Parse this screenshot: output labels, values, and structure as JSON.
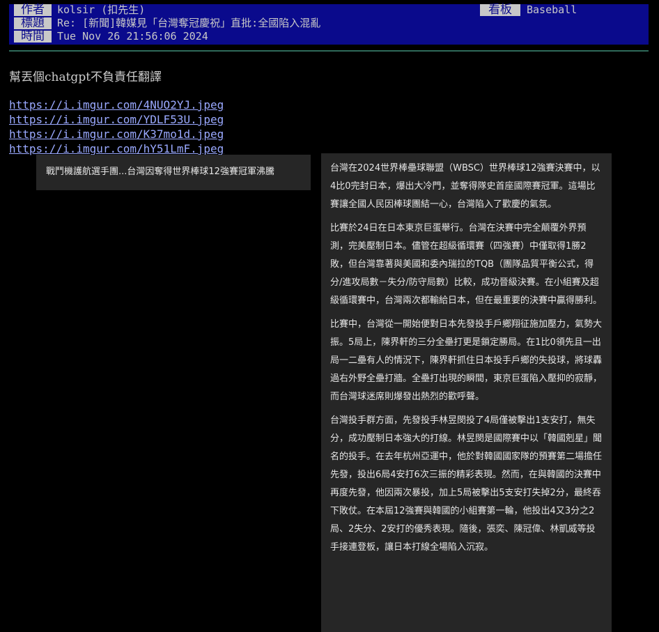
{
  "header": {
    "author_label": "作者",
    "author_value": "kolsir (扣先生)",
    "title_label": "標題",
    "title_value": "Re: [新聞]韓媒見「台灣奪冠慶祝」直批:全國陷入混亂",
    "time_label": "時間",
    "time_value": "Tue Nov 26 21:56:06 2024",
    "board_label": "看板",
    "board_value": "Baseball"
  },
  "body": {
    "intro": "幫丟個chatgpt不負責任翻譯",
    "links": [
      "https://i.imgur.com/4NUO2YJ.jpeg",
      "https://i.imgur.com/YDLF53U.jpeg",
      "https://i.imgur.com/K37mo1d.jpeg",
      "https://i.imgur.com/hY51LmF.jpeg"
    ]
  },
  "preview_left": {
    "text": "戰鬥機護航選手團...台灣因奪得世界棒球12強賽冠軍沸騰"
  },
  "preview_right": {
    "paragraphs": [
      "台灣在2024世界棒壘球聯盟（WBSC）世界棒球12強賽決賽中，以4比0完封日本，爆出大冷門，並奪得隊史首座國際賽冠軍。這場比賽讓全國人民因棒球團結一心，台灣陷入了歡慶的氣氛。",
      "比賽於24日在日本東京巨蛋舉行。台灣在決賽中完全顛覆外界預測，完美壓制日本。儘管在超級循環賽（四強賽）中僅取得1勝2敗，但台灣靠著與美國和委內瑞拉的TQB（團隊品質平衡公式，得分/進攻局數－失分/防守局數）比較，成功晉級決賽。在小組賽及超級循環賽中，台灣兩次都輸給日本，但在最重要的決賽中贏得勝利。",
      "比賽中，台灣從一開始便對日本先發投手戶鄉翔征施加壓力，氣勢大振。5局上，陳界軒的三分全壘打更是鎖定勝局。在1比0領先且一出局一二壘有人的情況下，陳界軒抓住日本投手戶鄉的失投球，將球轟過右外野全壘打牆。全壘打出現的瞬間，東京巨蛋陷入壓抑的寂靜，而台灣球迷席則爆發出熱烈的歡呼聲。",
      "台灣投手群方面，先發投手林昱閔投了4局僅被擊出1支安打，無失分，成功壓制日本強大的打線。林昱閔是國際賽中以「韓國剋星」聞名的投手。在去年杭州亞運中，他於對韓國國家隊的預賽第二場擔任先發，投出6局4安打6次三振的精彩表現。然而，在與韓國的決賽中再度先發，他因兩次暴投，加上5局被擊出5支安打失掉2分，最終吞下敗仗。在本屆12強賽與韓國的小組賽第一輪，他投出4又3分之2局、2失分、2安打的優秀表現。隨後，張奕、陳冠偉、林凱威等投手接連登板，讓日本打線全場陷入沉寂。"
    ]
  },
  "colors": {
    "header_bg": "#0a0a8c",
    "label_bg": "#c8c8c8",
    "link": "#9aa9ff",
    "card_bg": "#262626",
    "divider": "#2f6a5a"
  }
}
